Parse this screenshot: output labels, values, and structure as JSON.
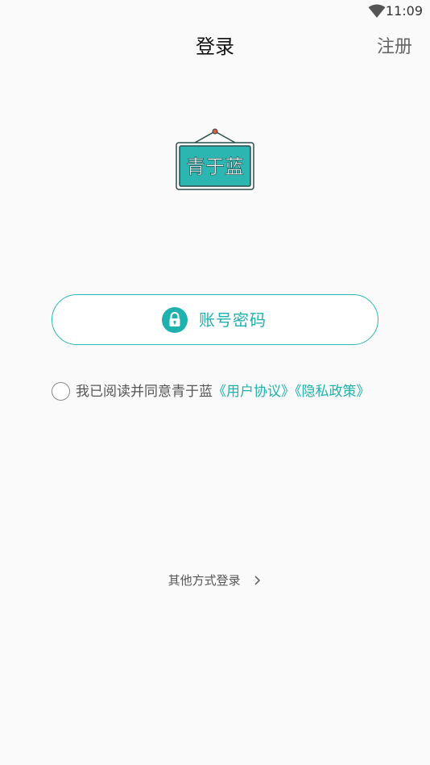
{
  "status_bar": {
    "time": "11:09",
    "wifi_icon": "wifi-icon"
  },
  "header": {
    "title": "登录",
    "register_label": "注册"
  },
  "logo": {
    "text": "青于蓝",
    "icon": "hanging-sign-logo"
  },
  "login_button": {
    "label": "账号密码",
    "icon": "lock-icon"
  },
  "agreement": {
    "text": "我已阅读并同意青于蓝",
    "user_agreement": "《用户协议》",
    "privacy_policy": "《隐私政策》",
    "checked": false
  },
  "other_login": {
    "label": "其他方式登录",
    "icon": "chevron-right-icon"
  },
  "colors": {
    "accent": "#1fb1ad",
    "background": "#fafafa"
  }
}
